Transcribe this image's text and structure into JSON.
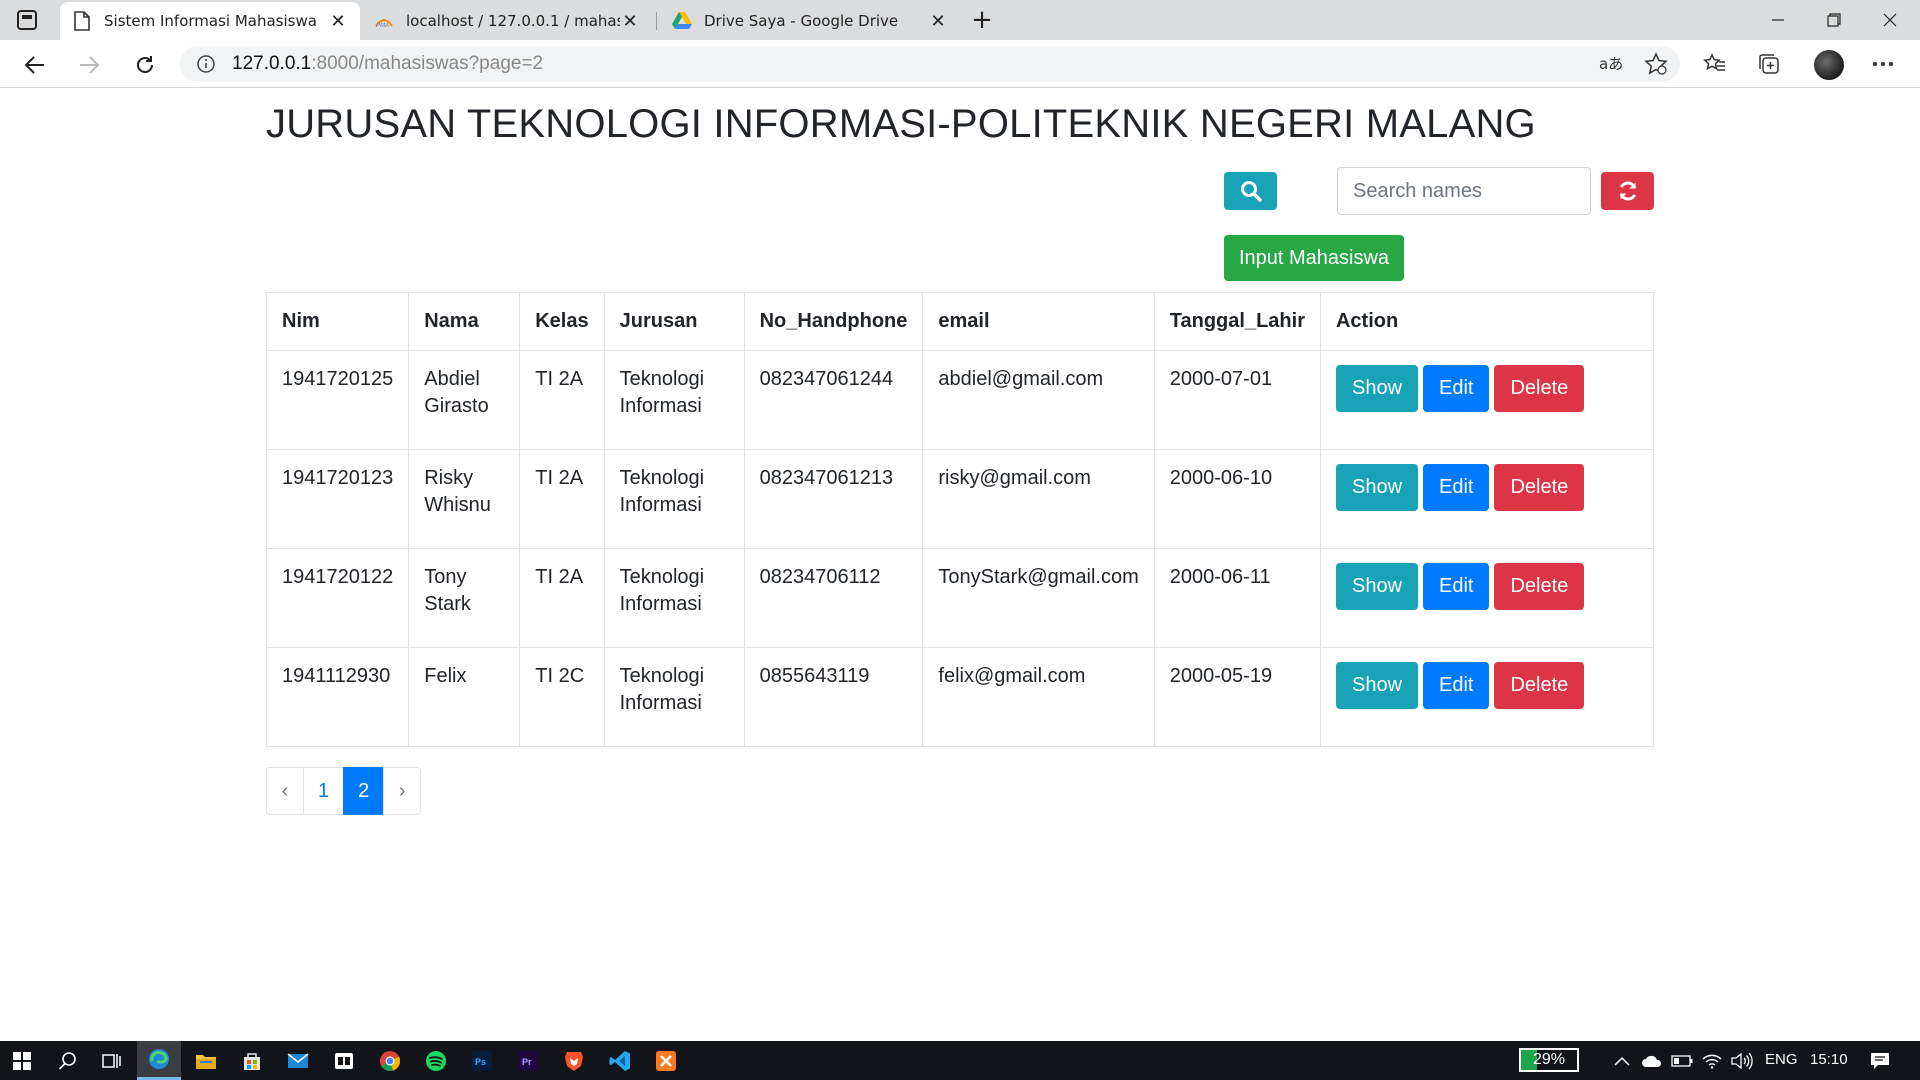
{
  "browser": {
    "tabs": [
      {
        "title": "Sistem Informasi Mahasiswa",
        "icon": "page-icon",
        "active": true
      },
      {
        "title": "localhost / 127.0.0.1 / mahasiswa",
        "icon": "phpmyadmin-icon",
        "active": false
      },
      {
        "title": "Drive Saya - Google Drive",
        "icon": "google-drive-icon",
        "active": false
      }
    ],
    "url_host": "127.0.0.1",
    "url_rest": ":8000/mahasiswas?page=2"
  },
  "page": {
    "title": "JURUSAN TEKNOLOGI INFORMASI-POLITEKNIK NEGERI MALANG",
    "search_placeholder": "Search names",
    "input_button": "Input Mahasiswa",
    "columns": [
      "Nim",
      "Nama",
      "Kelas",
      "Jurusan",
      "No_Handphone",
      "email",
      "Tanggal_Lahir",
      "Action"
    ],
    "rows": [
      {
        "nim": "1941720125",
        "nama_1": "Abdiel",
        "nama_2": "Girasto",
        "kelas": "TI 2A",
        "jurusan_1": "Teknologi",
        "jurusan_2": "Informasi",
        "hp": "082347061244",
        "email": "abdiel@gmail.com",
        "tgl": "2000-07-01"
      },
      {
        "nim": "1941720123",
        "nama_1": "Risky",
        "nama_2": "Whisnu",
        "kelas": "TI 2A",
        "jurusan_1": "Teknologi",
        "jurusan_2": "Informasi",
        "hp": "082347061213",
        "email": "risky@gmail.com",
        "tgl": "2000-06-10"
      },
      {
        "nim": "1941720122",
        "nama_1": "Tony",
        "nama_2": "Stark",
        "kelas": "TI 2A",
        "jurusan_1": "Teknologi",
        "jurusan_2": "Informasi",
        "hp": "08234706112",
        "email": "TonyStark@gmail.com",
        "tgl": "2000-06-11"
      },
      {
        "nim": "1941112930",
        "nama_1": "Felix",
        "nama_2": "",
        "kelas": "TI 2C",
        "jurusan_1": "Teknologi",
        "jurusan_2": "Informasi",
        "hp": "0855643119",
        "email": "felix@gmail.com",
        "tgl": "2000-05-19"
      }
    ],
    "actions": {
      "show": "Show",
      "edit": "Edit",
      "delete": "Delete"
    },
    "pagination": {
      "prev": "‹",
      "pages": [
        "1",
        "2"
      ],
      "current": "2",
      "next": "›"
    }
  },
  "colors": {
    "info": "#17a2b8",
    "primary": "#007bff",
    "danger": "#dc3545",
    "success": "#28a745"
  },
  "taskbar": {
    "battery": "29%",
    "battery_level": 0.29,
    "language": "ENG",
    "time": "15:10"
  }
}
